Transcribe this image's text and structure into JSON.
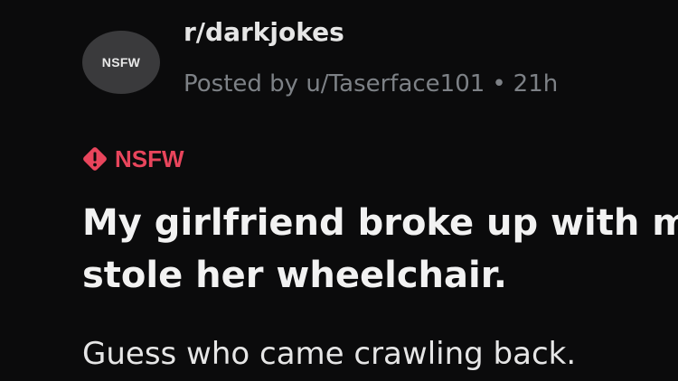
{
  "post": {
    "avatar_label": "NSFW",
    "avatar_icon": "nsfw-avatar-icon",
    "subreddit": "r/darkjokes",
    "byline": {
      "posted_by": "Posted by u/Taserface101",
      "separator": "•",
      "age": "21h"
    },
    "flair": {
      "icon": "warning-diamond-icon",
      "label": "NSFW",
      "color": "#e8455c"
    },
    "title_lines": [
      "My girlfriend broke up with me, so I",
      "stole her wheelchair."
    ],
    "body": "Guess who came crawling back."
  }
}
